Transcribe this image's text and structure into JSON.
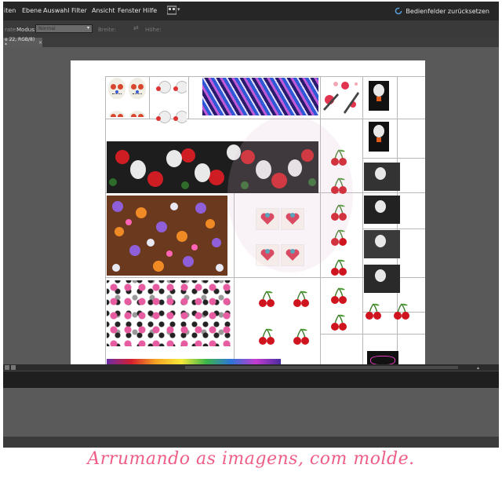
{
  "menubar": {
    "items": [
      "iten",
      "Ebene",
      "Auswahl",
      "Filter",
      "Ansicht",
      "Fenster",
      "Hilfe"
    ],
    "reset_label": "Bedienfelder zurücksetzen"
  },
  "options": {
    "left_label": "rate",
    "mode_label": "Modus:",
    "mode_value": "Normal",
    "breite_label": "Breite:",
    "hoehe_label": "Höhe:"
  },
  "doc_tab": {
    "label": "e 22, RGB/8) *",
    "close": "×"
  },
  "caption": "Arrumando as imagens, com molde.",
  "colors": {
    "menubar_bg": "#262626",
    "canvas_bg": "#595959",
    "caption": "#ee5e86"
  },
  "icons": [
    "workspace-icon",
    "reset-icon",
    "swap-icon",
    "close-icon"
  ]
}
